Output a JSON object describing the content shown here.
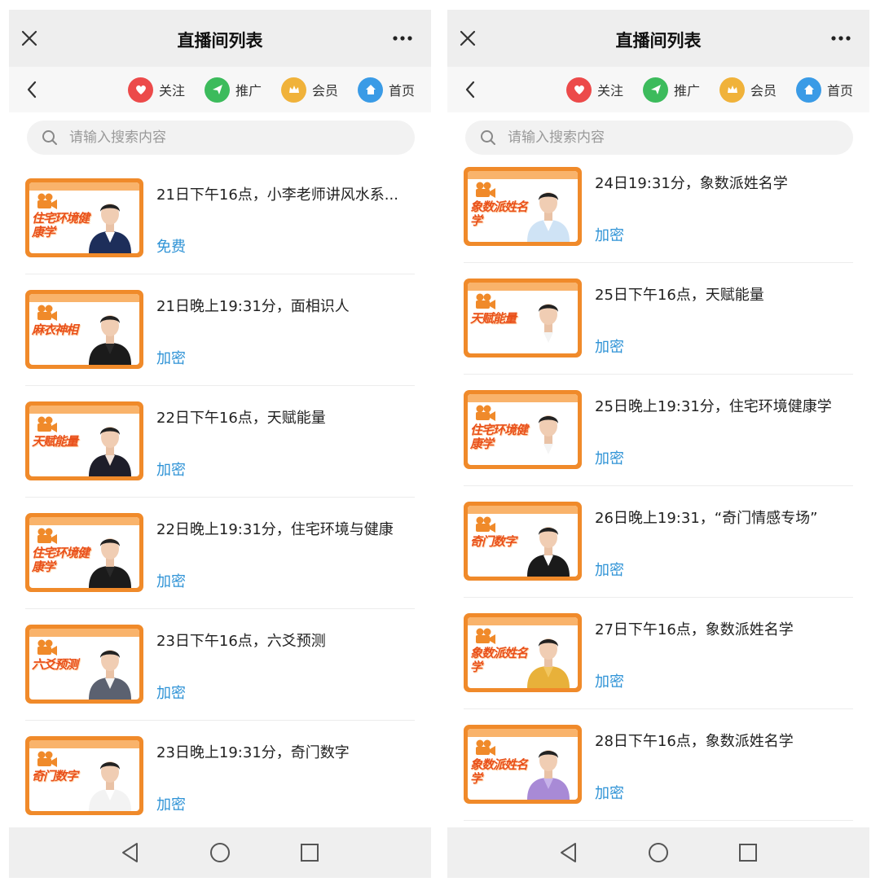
{
  "screens": [
    {
      "title": "直播间列表",
      "nav": [
        {
          "label": "关注",
          "icon": "heart-icon",
          "color": "#ec4a4a"
        },
        {
          "label": "推广",
          "icon": "send-icon",
          "color": "#3cbb5c"
        },
        {
          "label": "会员",
          "icon": "crown-icon",
          "color": "#f0b23a"
        },
        {
          "label": "首页",
          "icon": "home-icon",
          "color": "#3a9be6"
        }
      ],
      "search_placeholder": "请输入搜索内容",
      "items": [
        {
          "tag": "住宅环境健康学",
          "title": "21日下午16点，小李老师讲风水系...",
          "price": "免费",
          "suit": "#1d2e5a",
          "shirt": "#ffffff"
        },
        {
          "tag": "麻衣神相",
          "title": "21日晚上19:31分，面相识人",
          "price": "加密",
          "suit": "#1b1b1b",
          "shirt": "#2a2a2a"
        },
        {
          "tag": "天赋能量",
          "title": "22日下午16点，天赋能量",
          "price": "加密",
          "suit": "#1e1e2a",
          "shirt": "#f2e2d8"
        },
        {
          "tag": "住宅环境健康学",
          "title": "22日晚上19:31分，住宅环境与健康",
          "price": "加密",
          "suit": "#1b1b1b",
          "shirt": "#2a2a2a"
        },
        {
          "tag": "六爻预测",
          "title": "23日下午16点，六爻预测",
          "price": "加密",
          "suit": "#5b6170",
          "shirt": "#f5f5f5"
        },
        {
          "tag": "奇门数字",
          "title": "23日晚上19:31分，奇门数字",
          "price": "加密",
          "suit": "#f3f3f3",
          "shirt": "#ffffff"
        }
      ]
    },
    {
      "title": "直播间列表",
      "nav": [
        {
          "label": "关注",
          "icon": "heart-icon",
          "color": "#ec4a4a"
        },
        {
          "label": "推广",
          "icon": "send-icon",
          "color": "#3cbb5c"
        },
        {
          "label": "会员",
          "icon": "crown-icon",
          "color": "#f0b23a"
        },
        {
          "label": "首页",
          "icon": "home-icon",
          "color": "#3a9be6"
        }
      ],
      "search_placeholder": "请输入搜索内容",
      "items": [
        {
          "tag": "象数派姓名学",
          "title": "24日19:31分，象数派姓名学",
          "price": "加密",
          "suit": "#cfe3f5",
          "shirt": "#ffffff"
        },
        {
          "tag": "天赋能量",
          "title": "25日下午16点，天赋能量",
          "price": "加密",
          "suit": "#ffffff",
          "shirt": "#f4f4f4"
        },
        {
          "tag": "住宅环境健康学",
          "title": "25日晚上19:31分，住宅环境健康学",
          "price": "加密",
          "suit": "#ffffff",
          "shirt": "#f4f4f4"
        },
        {
          "tag": "奇门数字",
          "title": "26日晚上19:31，“奇门情感专场”",
          "price": "加密",
          "suit": "#1a1a1a",
          "shirt": "#ffffff"
        },
        {
          "tag": "象数派姓名学",
          "title": "27日下午16点，象数派姓名学",
          "price": "加密",
          "suit": "#e8b13a",
          "shirt": "#f2c660"
        },
        {
          "tag": "象数派姓名学",
          "title": "28日下午16点，象数派姓名学",
          "price": "加密",
          "suit": "#a88ad6",
          "shirt": "#c7b3ea"
        }
      ]
    }
  ]
}
